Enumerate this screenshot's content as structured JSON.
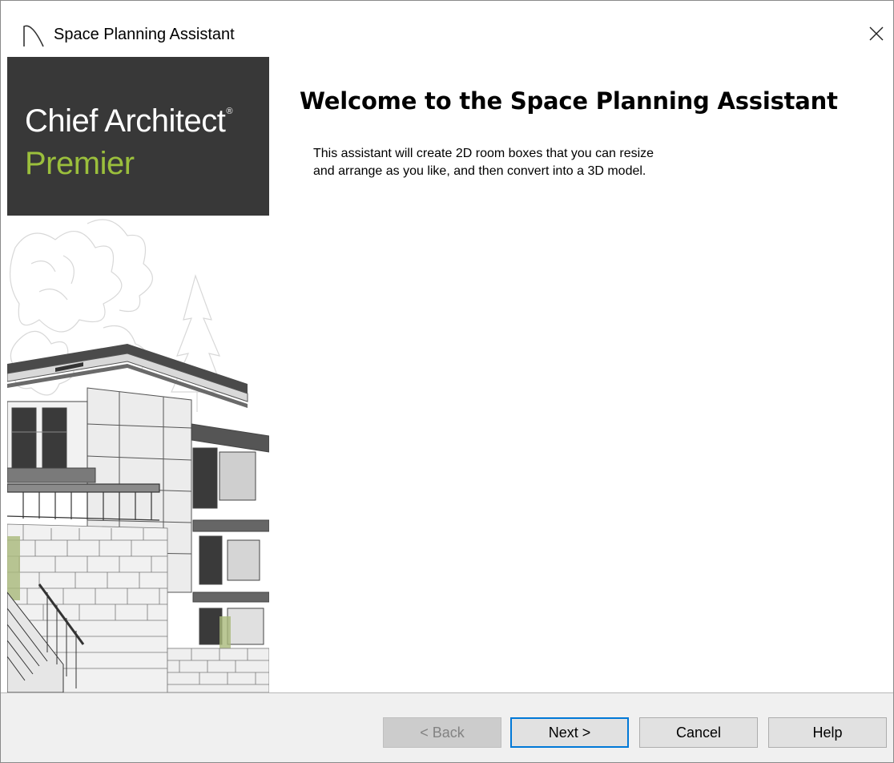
{
  "window": {
    "title": "Space Planning Assistant",
    "close_symbol": "✕"
  },
  "banner": {
    "brand_line1": "Chief Architect",
    "brand_registered": "®",
    "brand_line2": "Premier",
    "colors": {
      "block_background": "#383838",
      "brand_accent": "#9bbf3c"
    }
  },
  "main": {
    "heading": "Welcome to the Space Planning Assistant",
    "description_lines": [
      "This assistant will create 2D room boxes that you can resize",
      "and arrange as you like, and then convert into a 3D model."
    ]
  },
  "footer": {
    "back_label": "< Back",
    "next_label": "Next >",
    "cancel_label": "Cancel",
    "help_label": "Help"
  },
  "icons": [
    "app-arch-icon",
    "close-icon"
  ]
}
